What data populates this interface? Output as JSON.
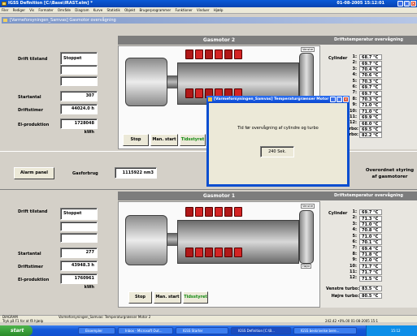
{
  "window": {
    "title": "IGSS Definition [C:\\Base\\IRAST.elm] *",
    "clock": "01-08-2005  15:12:01"
  },
  "menu": [
    "Filer",
    "Rediger",
    "Vis",
    "Formater",
    "Område",
    "Diagram",
    "Kurve",
    "Statistik",
    "Objekt",
    "Brugerprogrammer",
    "Funktioner",
    "Vinduer",
    "Hjælp"
  ],
  "inner_title": "[Varmeforsyningen_Samvas] Gasmotor overvågning",
  "motor2": {
    "title": "Gasmotor 2",
    "temp_title": "Driftstemperatur overvågning",
    "drift_label": "Drift tilstand",
    "drift_value": "Stoppet",
    "startantal_label": "Startantal",
    "startantal_value": "307",
    "driftstimer_label": "Driftstimer",
    "driftstimer_value": "44024.0 h",
    "el_label": "El-produktion",
    "el_value": "1728048 kWh",
    "cylinder_label": "Cylinder",
    "cylinders": [
      {
        "n": "1:",
        "v": "68.7 °C"
      },
      {
        "n": "2:",
        "v": "69.7 °C"
      },
      {
        "n": "3:",
        "v": "70.4 °C"
      },
      {
        "n": "4:",
        "v": "70.6 °C"
      },
      {
        "n": "5:",
        "v": "70.3 °C"
      },
      {
        "n": "6:",
        "v": "69.7 °C"
      },
      {
        "n": "7:",
        "v": "69.7 °C"
      },
      {
        "n": "8:",
        "v": "70.3 °C"
      },
      {
        "n": "9:",
        "v": "71.0 °C"
      },
      {
        "n": "10:",
        "v": "71.0 °C"
      },
      {
        "n": "11:",
        "v": "69.9 °C"
      },
      {
        "n": "12:",
        "v": "68.0 °C"
      }
    ],
    "turbo_partial_1": "urbo:",
    "turbo_value_1": "69.5 °C",
    "turbo_partial_2": "urbo:",
    "turbo_value_2": "82.2 °C",
    "venstre_tag": "Venstre",
    "hojre_tag": "Højre",
    "stop": "Stop",
    "man_start": "Man. start",
    "tidsstyret": "Tidsstyret"
  },
  "middle": {
    "alarm": "Alarm panel",
    "gasforbrug_label": "Gasforbrug",
    "gasforbrug_value": "1115922 nm3",
    "overordnet": "Overordnet styring af gasmotorer"
  },
  "motor1": {
    "title": "Gasmotor 1",
    "temp_title": "Driftstemperatur overvågning",
    "drift_label": "Drift tilstand",
    "drift_value": "Stoppet",
    "startantal_label": "Startantal",
    "startantal_value": "277",
    "driftstimer_label": "Driftstimer",
    "driftstimer_value": "43948.3 h",
    "el_label": "El-produktion",
    "el_value": "1760961 kWh",
    "cylinder_label": "Cylinder",
    "cylinders": [
      {
        "n": "1:",
        "v": "69.7 °C"
      },
      {
        "n": "2:",
        "v": "71.3 °C"
      },
      {
        "n": "3:",
        "v": "71.0 °C"
      },
      {
        "n": "4:",
        "v": "70.8 °C"
      },
      {
        "n": "5:",
        "v": "71.0 °C"
      },
      {
        "n": "6:",
        "v": "70.1 °C"
      },
      {
        "n": "7:",
        "v": "69.4 °C"
      },
      {
        "n": "8:",
        "v": "71.8 °C"
      },
      {
        "n": "9:",
        "v": "72.0 °C"
      },
      {
        "n": "10:",
        "v": "71.7 °C"
      },
      {
        "n": "11:",
        "v": "71.7 °C"
      },
      {
        "n": "12:",
        "v": "71.5 °C"
      }
    ],
    "venstre_turbo_label": "Venstre turbo:",
    "venstre_turbo_value": "83.5 °C",
    "hojre_turbo_label": "Højre turbo:",
    "hojre_turbo_value": "80.5 °C",
    "venstre_tag": "Venstre",
    "hojre_tag": "Højre",
    "stop": "Stop",
    "man_start": "Man. start",
    "tidsstyret": "Tidsstyret"
  },
  "dialog": {
    "title": "[Varmeforsyningen_Samvas] Temperaturgrænser Motor 2",
    "message": "Tid før overvågning af cylindre og turbo",
    "value": "240 Sek."
  },
  "status": {
    "left": "DIAGRAM",
    "mid": "Varmeforsyningen_Samvas: Temperaturgrænser Motor 2",
    "line2": "Tryk på F1 for at få hjælp",
    "right": "242.42    •0%.00    01-08-2005  15:1"
  },
  "taskbar": {
    "start": "start",
    "tasks": [
      "Eksempler",
      "Inbox - Microsoft Out...",
      "IGSS Starter",
      "IGSS Definition [C:\\B...",
      "IGSS beskrivelse bere..."
    ],
    "clock": "15:12"
  }
}
